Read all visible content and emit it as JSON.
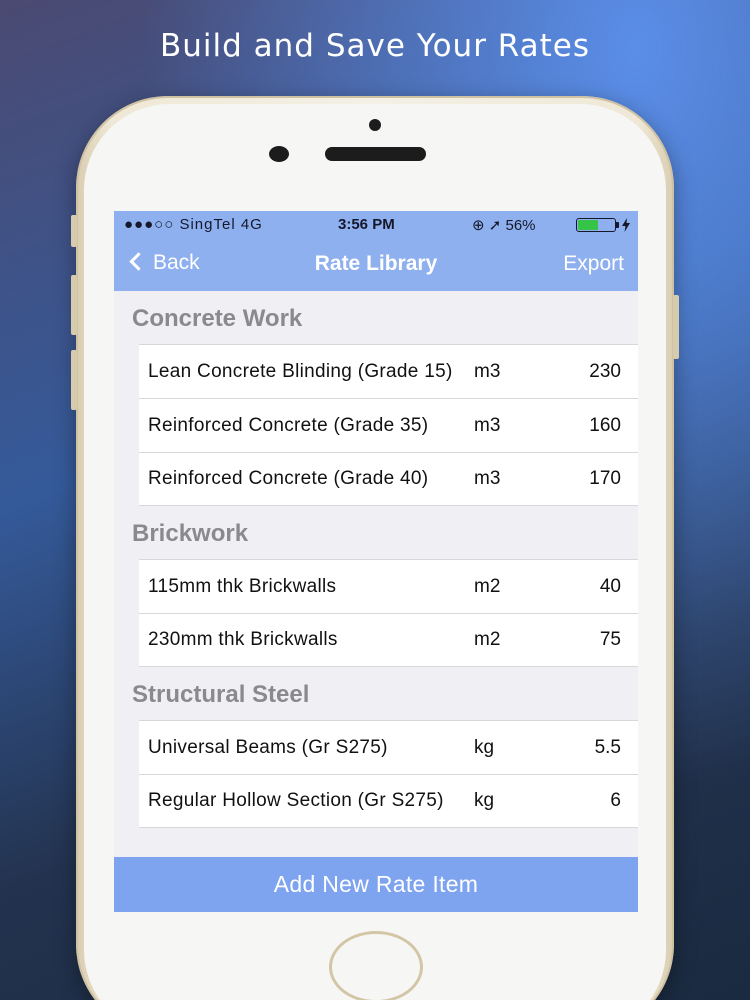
{
  "headline": "Build and Save Your Rates",
  "status_bar": {
    "signal": "●●●○○ SingTel   4G",
    "time": "3:56 PM",
    "right": "⊕ ➚ 56%",
    "battery_level_percent": 56,
    "battery_charging_icon": "bolt-icon"
  },
  "nav": {
    "back_label": "Back",
    "title": "Rate Library",
    "export_label": "Export"
  },
  "sections": [
    {
      "title": "Concrete Work",
      "items": [
        {
          "name": "Lean Concrete Blinding (Grade 15)",
          "unit": "m3",
          "rate": "230"
        },
        {
          "name": "Reinforced Concrete (Grade 35)",
          "unit": "m3",
          "rate": "160"
        },
        {
          "name": "Reinforced Concrete (Grade 40)",
          "unit": "m3",
          "rate": "170"
        }
      ]
    },
    {
      "title": "Brickwork",
      "items": [
        {
          "name": "115mm thk Brickwalls",
          "unit": "m2",
          "rate": "40"
        },
        {
          "name": "230mm thk Brickwalls",
          "unit": "m2",
          "rate": "75"
        }
      ]
    },
    {
      "title": "Structural Steel",
      "items": [
        {
          "name": "Universal Beams (Gr S275)",
          "unit": "kg",
          "rate": "5.5"
        },
        {
          "name": "Regular Hollow Section (Gr S275)",
          "unit": "kg",
          "rate": "6"
        }
      ]
    }
  ],
  "add_button_label": "Add New Rate Item",
  "colors": {
    "nav_blue": "#8fb0ef",
    "button_blue": "#7ea3ef",
    "section_gray": "#8a8a8e",
    "phone_gold": "#efe8d6"
  }
}
